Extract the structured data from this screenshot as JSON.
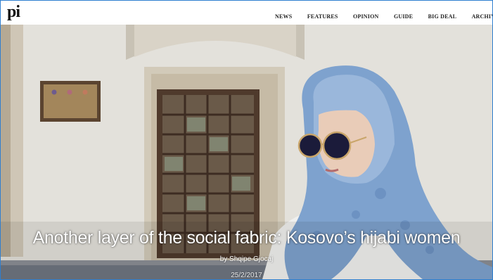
{
  "site": {
    "logo": "pi",
    "nav": [
      {
        "label": "NEWS"
      },
      {
        "label": "FEATURES"
      },
      {
        "label": "OPINION"
      },
      {
        "label": "GUIDE"
      },
      {
        "label": "BIG DEAL"
      },
      {
        "label": "ARCHIV"
      }
    ]
  },
  "hero": {
    "headline": "Another layer of the social fabric: Kosovo’s hijabi women",
    "byline": "by Shqipe Gjocaj",
    "date": "25/2/2017"
  },
  "colors": {
    "frame_border": "#2f7fd0",
    "headscarf": "#7fa3cf",
    "wall": "#e6e4de",
    "window_frame": "#5a4133"
  }
}
